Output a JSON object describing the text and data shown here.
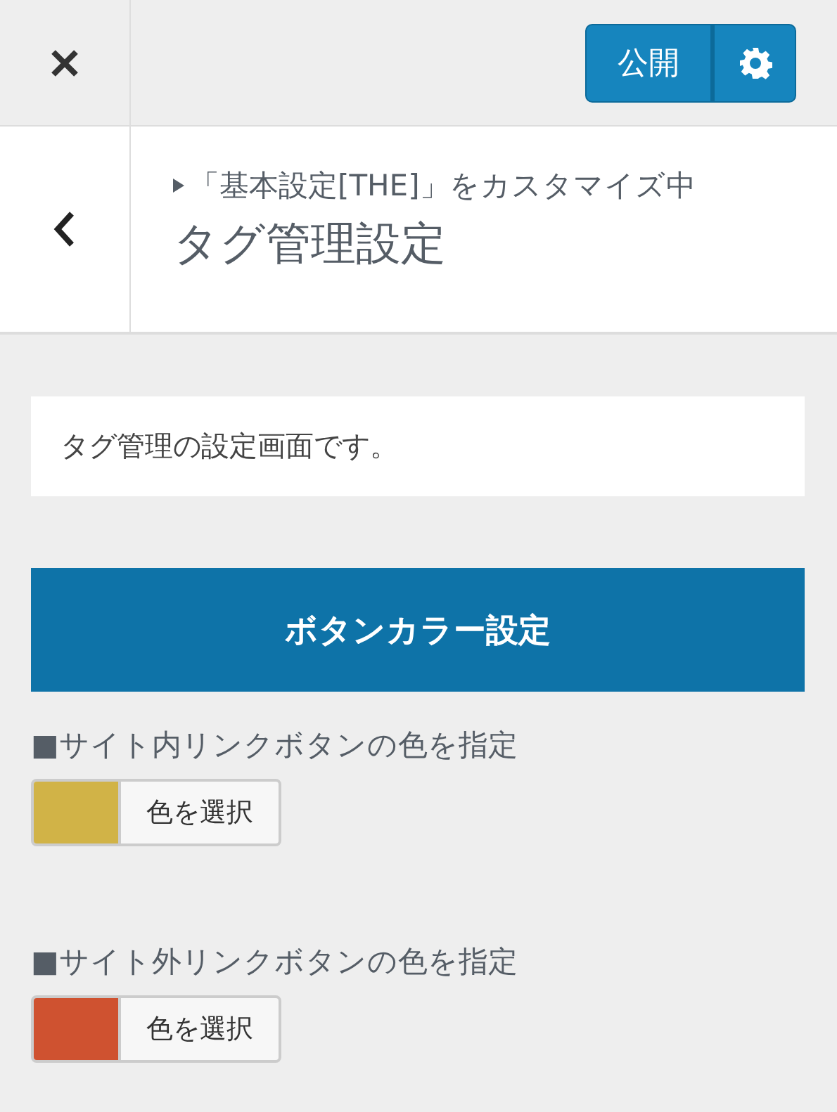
{
  "topbar": {
    "publish": "公開"
  },
  "header": {
    "breadcrumb": "「基本設定[THE]」をカスタマイズ中",
    "title": "タグ管理設定"
  },
  "description": "タグ管理の設定画面です。",
  "section_heading": "ボタンカラー設定",
  "controls": [
    {
      "label": "■サイト内リンクボタンの色を指定",
      "color": "#d1b347",
      "button": "色を選択"
    },
    {
      "label": "■サイト外リンクボタンの色を指定",
      "color": "#cf5230",
      "button": "色を選択"
    }
  ]
}
